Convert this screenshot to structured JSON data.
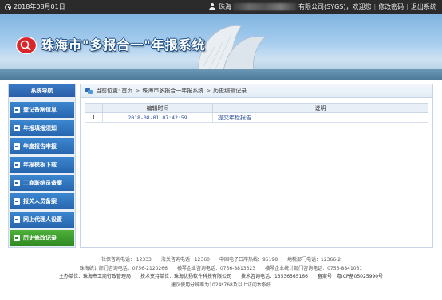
{
  "topbar": {
    "date": "2018年08月01日",
    "user_prefix": "珠海",
    "user_suffix": "有限公司(SYGS)，欢迎您",
    "change_password": "修改密码",
    "logout": "退出系统"
  },
  "banner": {
    "title": "珠海市\"多报合一\"年报系统"
  },
  "nav": {
    "header": "系统导航",
    "items": [
      {
        "label": "登记备案信息"
      },
      {
        "label": "年报填报须知"
      },
      {
        "label": "年度报告申报"
      },
      {
        "label": "年报模板下载"
      },
      {
        "label": "工商联络员备案"
      },
      {
        "label": "报关人员备案"
      },
      {
        "label": "网上代理人设置"
      },
      {
        "label": "历史修改记录"
      }
    ]
  },
  "breadcrumb": {
    "prefix": "当前位置:",
    "items": [
      "首页",
      "珠海市多报合一年报系统",
      "历史编辑记录"
    ]
  },
  "table": {
    "headers": [
      "编辑时间",
      "说明"
    ],
    "rows": [
      {
        "index": "1",
        "time": "2018-08-01 07:42:59",
        "desc": "提交年检报告"
      }
    ]
  },
  "footer": {
    "line1": "社保咨询电话： 12333　　海关咨询电话：12360　　中国电子口岸热线：95198　　地税部门电话：12366-2",
    "line2": "珠海统计部门咨询电话：0756-2120266　　横琴企业咨询电话：0756-8813323　　横琴企业统计部门咨询电话：0756-8841031",
    "line3": "主办单位：珠海市工商行政管理局　　技术支持单位：珠海优扬软件科技有限公司　　技术咨询电话：13536565166　　备案号：粤ICP备05025990号",
    "line4": "建议使用分辨率为1024*768及以上访问本系统"
  }
}
